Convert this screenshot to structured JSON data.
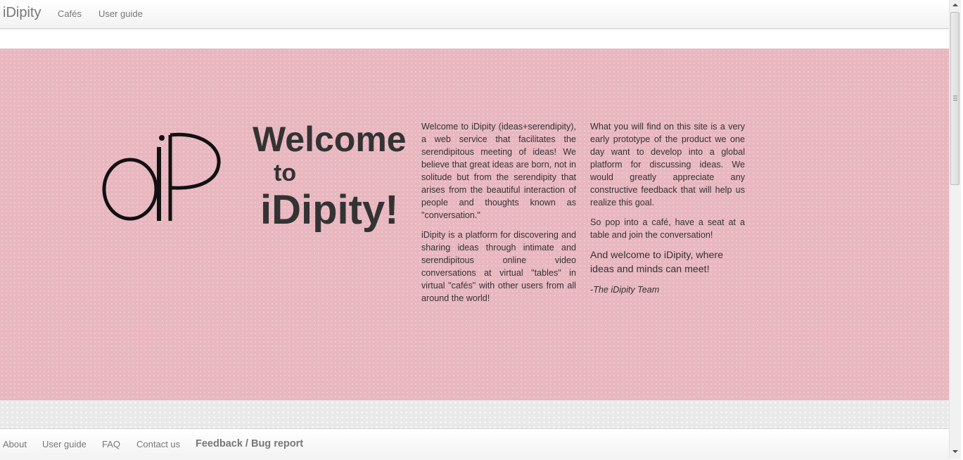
{
  "navbar": {
    "brand": "iDipity",
    "links": [
      "Cafés",
      "User guide"
    ]
  },
  "hero": {
    "title_line1": "Welcome",
    "title_line2": "to",
    "title_line3": "iDipity!",
    "logo_icon": "idipity-logo",
    "col1": {
      "p1": "Welcome to iDipity (ideas+serendipity), a web service that facilitates the serendipitous meeting of ideas! We believe that great ideas are born, not in solitude but from the serendipity that arises from the beautiful interaction of people and thoughts known as \"conversation.\"",
      "p2": "iDipity is a platform for discovering and sharing ideas through intimate and serendipitous online video conversations at virtual \"tables\" in virtual \"cafés\" with other users from all around the world!"
    },
    "col2": {
      "p1": "What you will find on this site is a very early prototype of the product we one day want to develop into a global platform for discussing ideas. We would greatly appreciate any constructive feedback that will help us realize this goal.",
      "p2": "So pop into a café, have a seat at a table and join the conversation!",
      "p3": "And welcome to iDipity, where ideas and minds can meet!",
      "signature": "-The iDipity Team"
    },
    "background_color": "#e8b7bf"
  },
  "footer": {
    "links": [
      "About",
      "User guide",
      "FAQ",
      "Contact us"
    ],
    "feedback_label": "Feedback / Bug report"
  }
}
